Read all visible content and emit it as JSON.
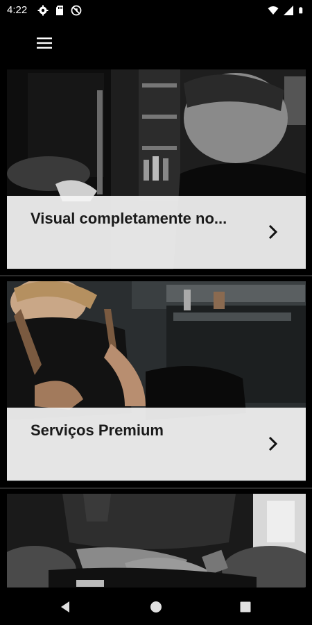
{
  "status_bar": {
    "time": "4:22",
    "left_icons": [
      "gear-icon",
      "sd-card-icon",
      "no-sync-icon"
    ],
    "right_icons": [
      "wifi-icon",
      "signal-icon",
      "battery-icon"
    ]
  },
  "app_bar": {
    "menu_icon": "hamburger-menu-icon"
  },
  "cards": [
    {
      "title": "Visual completamente no...",
      "image": "barber-at-work-grayscale-photo"
    },
    {
      "title": "Serviços Premium",
      "image": "barber-cutting-hair-photo"
    },
    {
      "title": "",
      "image": "barber-with-clipper-photo"
    }
  ],
  "nav_bar": {
    "buttons": [
      "back-icon",
      "home-icon",
      "recents-icon"
    ]
  }
}
